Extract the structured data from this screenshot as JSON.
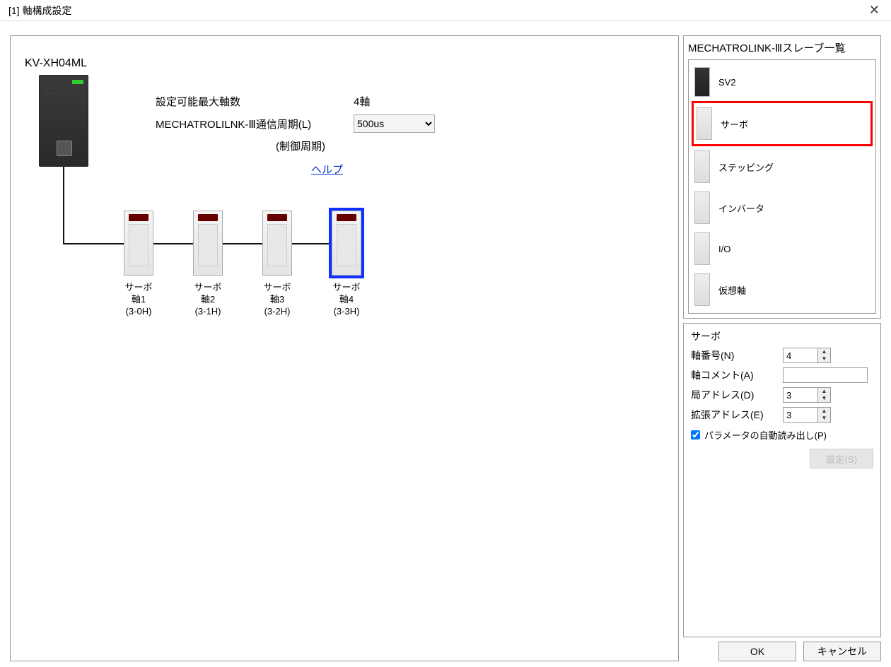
{
  "window": {
    "title": "[1] 軸構成設定"
  },
  "main": {
    "device_name": "KV-XH04ML",
    "max_axis_label": "設定可能最大軸数",
    "max_axis_value": "4軸",
    "cycle_label": "MECHATROLILNK-Ⅲ通信周期(L)",
    "cycle_sub": "(制御周期)",
    "cycle_value": "500us",
    "help": "ヘルプ",
    "units": [
      {
        "name": "サーボ",
        "axis": "軸1",
        "addr": "(3-0H)"
      },
      {
        "name": "サーボ",
        "axis": "軸2",
        "addr": "(3-1H)"
      },
      {
        "name": "サーボ",
        "axis": "軸3",
        "addr": "(3-2H)"
      },
      {
        "name": "サーボ",
        "axis": "軸4",
        "addr": "(3-3H)"
      }
    ]
  },
  "slave_panel": {
    "title": "MECHATROLINK-Ⅲスレーブ一覧",
    "items": [
      "SV2",
      "サーボ",
      "ステッピング",
      "インバータ",
      "I/O",
      "仮想軸"
    ]
  },
  "props": {
    "title": "サーボ",
    "axis_no_label": "軸番号(N)",
    "axis_no_value": "4",
    "comment_label": "軸コメント(A)",
    "comment_value": "",
    "station_label": "局アドレス(D)",
    "station_value": "3",
    "ext_label": "拡張アドレス(E)",
    "ext_value": "3",
    "auto_read_label": "パラメータの自動読み出し(P)",
    "settings_btn": "設定(S)"
  },
  "buttons": {
    "ok": "OK",
    "cancel": "キャンセル"
  }
}
